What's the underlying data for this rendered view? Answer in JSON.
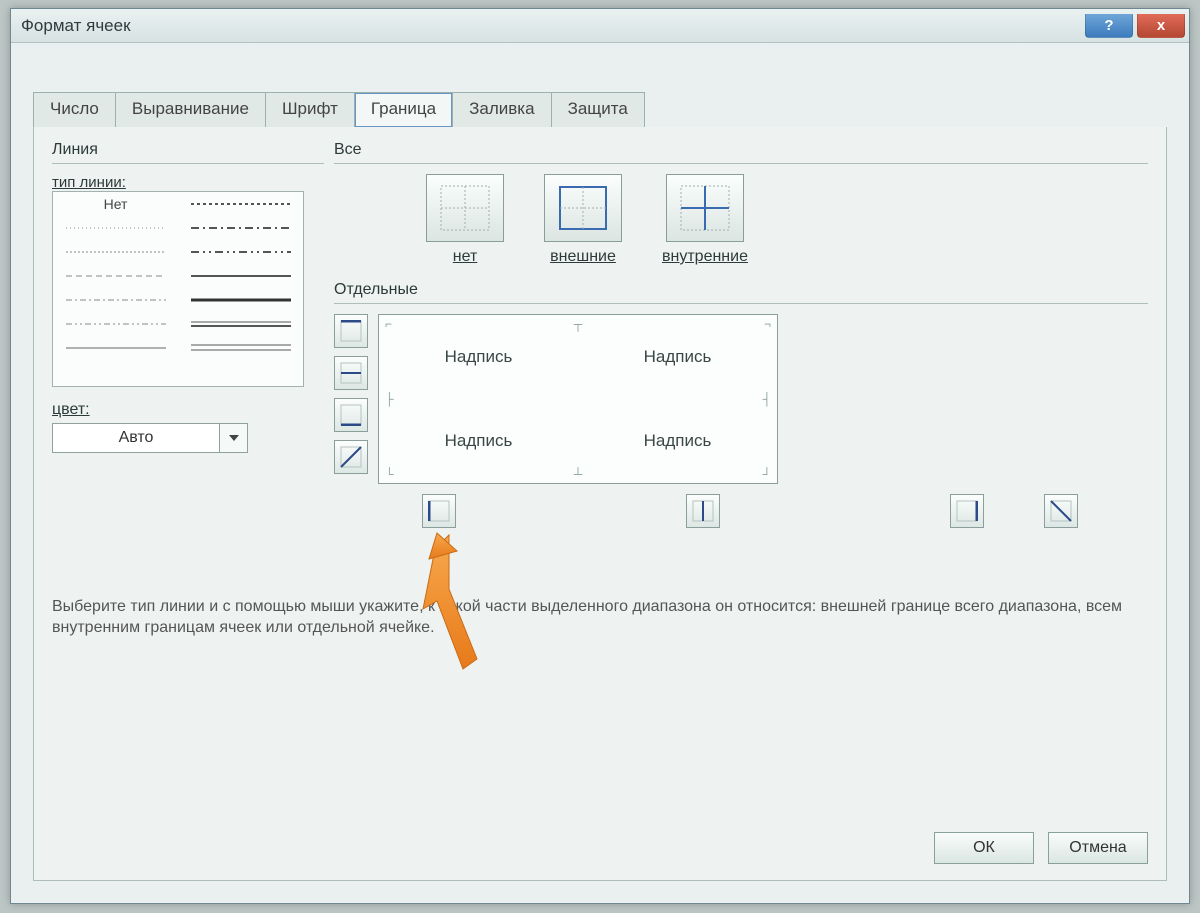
{
  "window": {
    "title": "Формат ячеек"
  },
  "tabs": {
    "items": [
      {
        "label": "Число"
      },
      {
        "label": "Выравнивание"
      },
      {
        "label": "Шрифт"
      },
      {
        "label": "Граница",
        "active": true
      },
      {
        "label": "Заливка"
      },
      {
        "label": "Защита"
      }
    ]
  },
  "line": {
    "group": "Линия",
    "style_label": "тип линии:",
    "none_label": "Нет",
    "color_label": "цвет:",
    "color_value": "Авто"
  },
  "presets": {
    "group": "Все",
    "items": [
      {
        "id": "none",
        "label": "нет",
        "underline": "н"
      },
      {
        "id": "outline",
        "label": "внешние",
        "underline": "в"
      },
      {
        "id": "inside",
        "label": "внутренние",
        "underline": "в"
      }
    ]
  },
  "individual": {
    "group": "Отдельные",
    "preview_text": "Надпись"
  },
  "help_text": "Выберите тип линии и с помощью мыши укажите, к какой части выделенного диапазона он относится: внешней границе всего диапазона, всем внутренним границам ячеек или отдельной ячейке.",
  "buttons": {
    "ok": "ОК",
    "cancel": "Отмена"
  }
}
